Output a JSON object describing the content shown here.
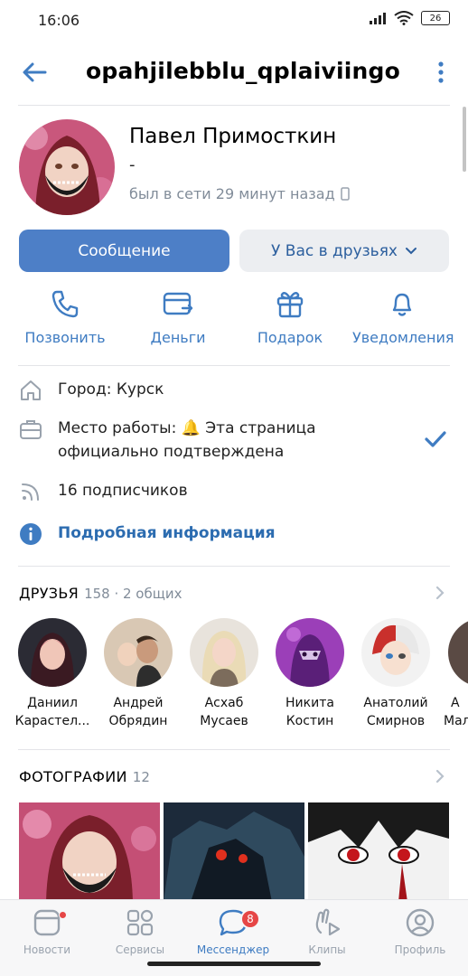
{
  "status_bar": {
    "time": "16:06",
    "battery": "26"
  },
  "header": {
    "title": "opahjilebblu_qplaiviingo"
  },
  "profile": {
    "name": "Павел Примосткин",
    "status": "-",
    "online": "был в сети 29 минут назад"
  },
  "buttons": {
    "message": "Сообщение",
    "friends": "У Вас в друзьях"
  },
  "actions": [
    {
      "label": "Позвонить",
      "icon": "phone-icon"
    },
    {
      "label": "Деньги",
      "icon": "money-icon"
    },
    {
      "label": "Подарок",
      "icon": "gift-icon"
    },
    {
      "label": "Уведомления",
      "icon": "bell-icon"
    }
  ],
  "info": {
    "city": "Город: Курск",
    "work_line1": "Место работы: 🔔 Эта страница",
    "work_line2": "официально подтверждена",
    "followers": "16 подписчиков",
    "more": "Подробная информация"
  },
  "friends_section": {
    "title": "ДРУЗЬЯ",
    "count": "158 · 2 общих",
    "items": [
      {
        "first": "Даниил",
        "last": "Карастел..."
      },
      {
        "first": "Андрей",
        "last": "Обрядин"
      },
      {
        "first": "Асхаб",
        "last": "Мусаев"
      },
      {
        "first": "Никита",
        "last": "Костин"
      },
      {
        "first": "Анатолий",
        "last": "Смирнов"
      },
      {
        "first": "А",
        "last": "Мал"
      }
    ]
  },
  "photos_section": {
    "title": "ФОТОГРАФИИ",
    "count": "12"
  },
  "tabbar": {
    "news": "Новости",
    "services": "Сервисы",
    "messenger": "Мессенджер",
    "messenger_badge": "8",
    "clips": "Клипы",
    "profile": "Профиль"
  },
  "colors": {
    "accent": "#4d7fc7",
    "link": "#3f7cc2",
    "secondary": "#818c99",
    "badge": "#e64646"
  }
}
